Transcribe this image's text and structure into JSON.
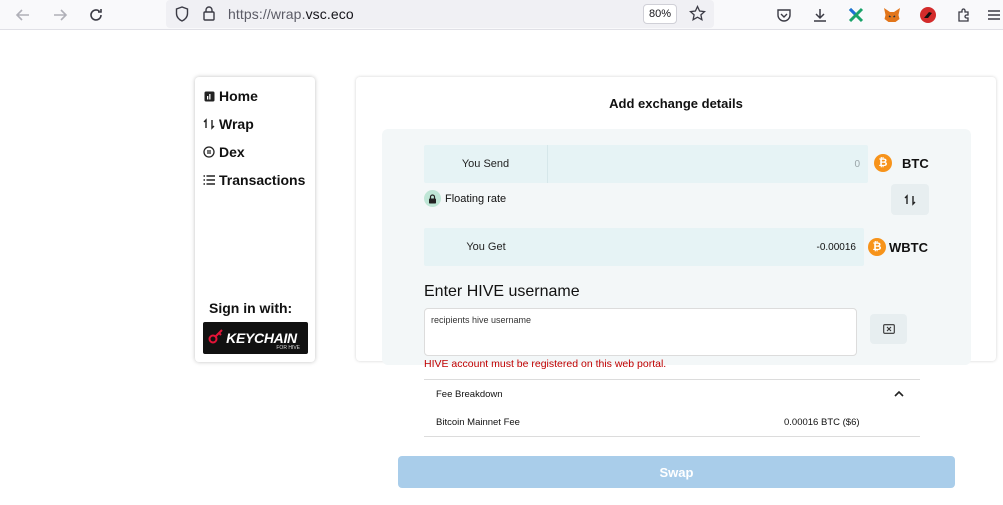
{
  "browser": {
    "url_prefix": "https://wrap.",
    "url_domain": "vsc.eco",
    "zoom": "80%"
  },
  "sidebar": {
    "items": [
      {
        "label": "Home",
        "icon": "home-icon"
      },
      {
        "label": "Wrap",
        "icon": "wrap-icon"
      },
      {
        "label": "Dex",
        "icon": "dex-icon"
      },
      {
        "label": "Transactions",
        "icon": "list-icon"
      }
    ],
    "sign_in_label": "Sign in with:",
    "keychain_logo": "KEYCHAIN",
    "keychain_sub": "FOR HIVE"
  },
  "main": {
    "title": "Add exchange details",
    "send": {
      "label": "You Send",
      "value": "0",
      "coin": "BTC"
    },
    "rate": {
      "label": "Floating rate"
    },
    "get": {
      "label": "You Get",
      "value": "-0.00016",
      "coin": "WBTC"
    },
    "hive": {
      "title": "Enter HIVE username",
      "placeholder": "recipients hive username",
      "warning": "HIVE account must be registered on this web portal."
    },
    "fee": {
      "title": "Fee Breakdown",
      "rows": [
        {
          "label": "Bitcoin Mainnet Fee",
          "value": "0.00016 BTC ($6)"
        }
      ]
    },
    "swap_label": "Swap"
  },
  "colors": {
    "btc": "#f7931a",
    "warning": "#c00000",
    "swap_button": "#a9cdea"
  }
}
